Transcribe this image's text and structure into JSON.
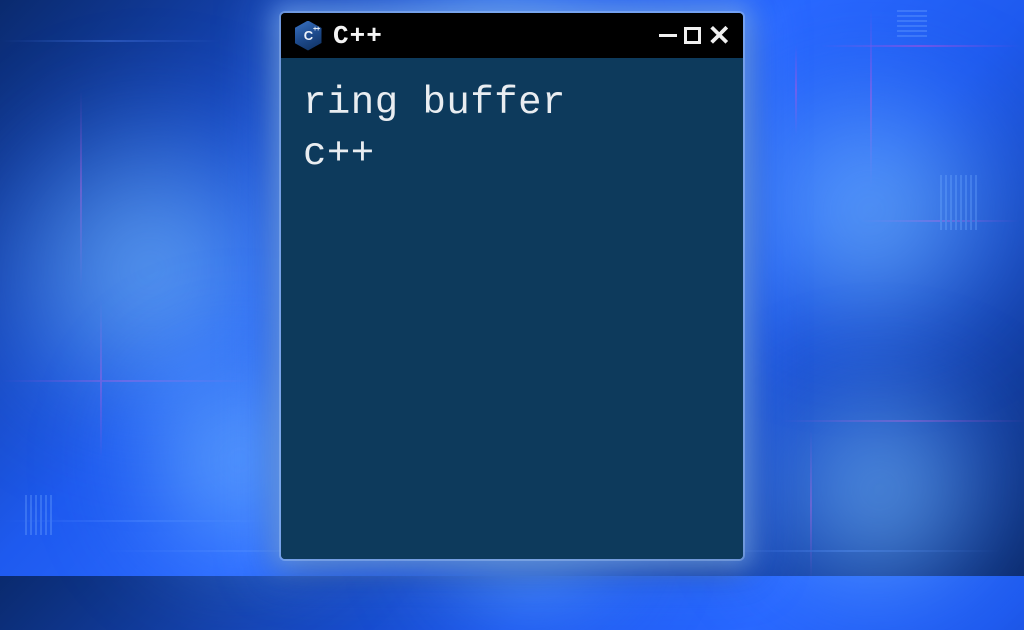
{
  "window": {
    "icon_label": "C",
    "icon_plus": "++",
    "title": "C++",
    "controls": {
      "minimize": "minimize",
      "maximize": "maximize",
      "close": "close"
    }
  },
  "terminal": {
    "line1": "ring buffer",
    "line2": "c++"
  }
}
